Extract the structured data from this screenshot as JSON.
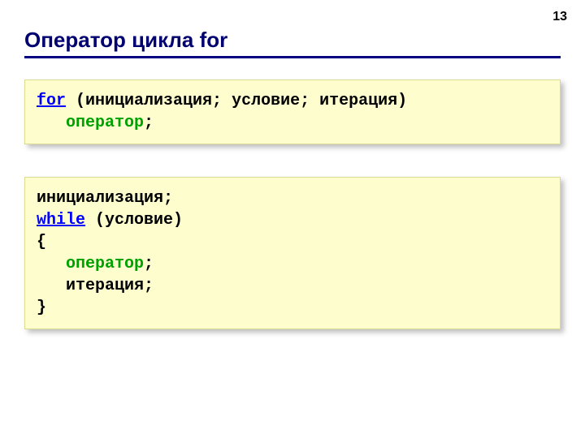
{
  "page_number": "13",
  "title": "Оператор цикла for",
  "box1": {
    "kw_for": "for",
    "line1_rest": "(инициализация; условие; итерация)",
    "indent": "   ",
    "operator": "оператор",
    "semicolon": ";"
  },
  "box2": {
    "line1": "инициализация;",
    "kw_while": "while",
    "line2_rest": "(условие)",
    "brace_open": "{",
    "indent": "   ",
    "operator": "оператор",
    "semicolon": ";",
    "line_iter": "   итерация;",
    "brace_close": "}"
  }
}
